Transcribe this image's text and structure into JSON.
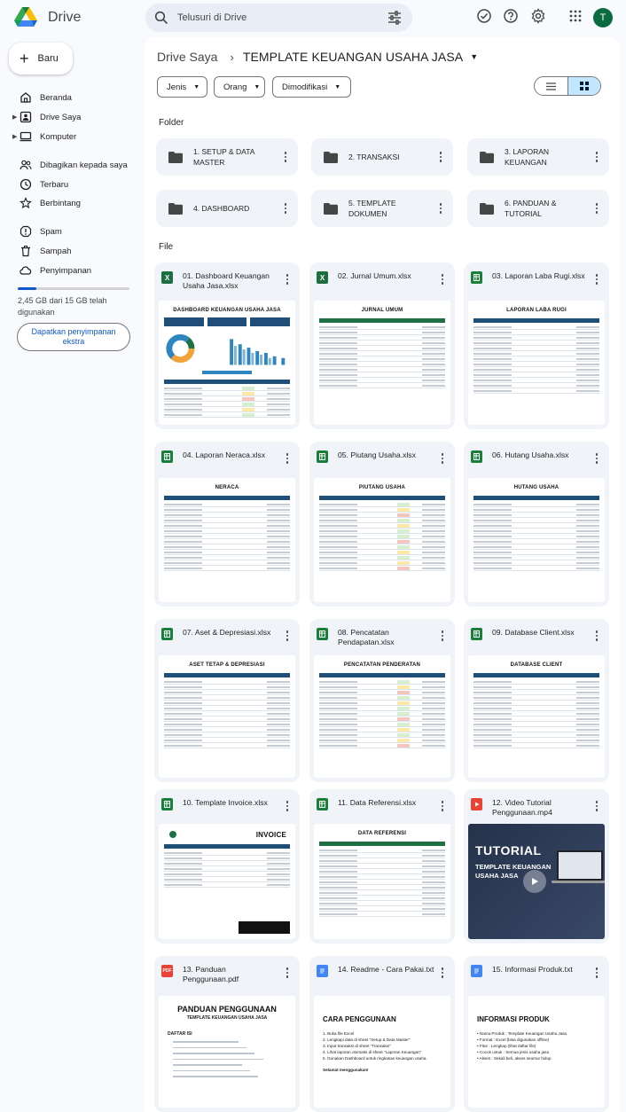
{
  "app": {
    "name": "Drive"
  },
  "search": {
    "placeholder": "Telusuri di Drive"
  },
  "user": {
    "initial": "T"
  },
  "new_button": {
    "label": "Baru"
  },
  "sidebar": {
    "items": [
      {
        "label": "Beranda",
        "icon": "home-icon"
      },
      {
        "label": "Drive Saya",
        "icon": "my-drive-icon"
      },
      {
        "label": "Komputer",
        "icon": "computer-icon"
      },
      {
        "label": "Dibagikan kepada saya",
        "icon": "shared-icon"
      },
      {
        "label": "Terbaru",
        "icon": "clock-icon"
      },
      {
        "label": "Berbintang",
        "icon": "star-icon"
      },
      {
        "label": "Spam",
        "icon": "spam-icon"
      },
      {
        "label": "Sampah",
        "icon": "trash-icon"
      },
      {
        "label": "Penyimpanan",
        "icon": "cloud-icon"
      }
    ],
    "storage_used_fraction": 0.163,
    "storage_text": "2,45 GB dari 15 GB telah digunakan",
    "get_storage": "Dapatkan penyimpanan ekstra"
  },
  "breadcrumb": {
    "root": "Drive Saya",
    "current": "TEMPLATE  KEUANGAN USAHA JASA"
  },
  "filters": [
    "Jenis",
    "Orang",
    "Dimodifikasi"
  ],
  "sections": {
    "folders": "Folder",
    "files": "File"
  },
  "folders": [
    "1. SETUP & DATA MASTER",
    "2. TRANSAKSI",
    "3. LAPORAN KEUANGAN",
    "4. DASHBOARD",
    "5. TEMPLATE DOKUMEN",
    "6. PANDUAN & TUTORIAL"
  ],
  "files": [
    {
      "name": "01. Dashboard Keuangan Usaha Jasa.xlsx",
      "type": "xlsx-excel",
      "thumb_title": "DASHBOARD KEUANGAN USAHA JASA"
    },
    {
      "name": "02. Jurnal Umum.xlsx",
      "type": "xlsx-excel",
      "thumb_title": "JURNAL UMUM"
    },
    {
      "name": "03. Laporan Laba Rugi.xlsx",
      "type": "xlsx-sheets",
      "thumb_title": "LAPORAN LABA RUGI"
    },
    {
      "name": "04. Laporan Neraca.xlsx",
      "type": "xlsx-sheets",
      "thumb_title": "NERACA"
    },
    {
      "name": "05. Piutang Usaha.xlsx",
      "type": "xlsx-sheets",
      "thumb_title": "PIUTANG USAHA"
    },
    {
      "name": "06. Hutang Usaha.xlsx",
      "type": "xlsx-sheets",
      "thumb_title": "HUTANG USAHA"
    },
    {
      "name": "07. Aset & Depresiasi.xlsx",
      "type": "xlsx-sheets",
      "thumb_title": "ASET TETAP & DEPRESIASI"
    },
    {
      "name": "08. Pencatatan Pendapatan.xlsx",
      "type": "xlsx-sheets",
      "thumb_title": "PENCATATAN PENDERATAN"
    },
    {
      "name": "09. Database Client.xlsx",
      "type": "xlsx-sheets",
      "thumb_title": "DATABASE CLIENT"
    },
    {
      "name": "10. Template Invoice.xlsx",
      "type": "xlsx-sheets",
      "thumb_title": "INVOICE"
    },
    {
      "name": "11. Data Referensi.xlsx",
      "type": "xlsx-sheets",
      "thumb_title": "DATA REFERENSI"
    },
    {
      "name": "12. Video Tutorial Penggunaan.mp4",
      "type": "video",
      "thumb_title": "TUTORIAL",
      "thumb_subtitle": "TEMPLATE KEUANGAN USAHA JASA"
    },
    {
      "name": "13. Panduan Penggunaan.pdf",
      "type": "pdf",
      "thumb_title": "PANDUAN PENGGUNAAN",
      "thumb_subtitle": "TEMPLATE KEUANGAN USAHA JASA",
      "thumb_section": "DAFTAR ISI"
    },
    {
      "name": "14. Readme - Cara Pakai.txt",
      "type": "doc",
      "thumb_title": "CARA PENGGUNAAN",
      "lines": [
        "1. Buka file Excel",
        "2. Lengkapi data di sheet \"Setup & Data Master\"",
        "3. Input transaksi di sheet \"Transaksi\"",
        "4. Lihat laporan otomatis di sheet \"Laporan Keuangan\"",
        "5. Gunakan Dashboard untuk ringkasan keuangan usaha."
      ],
      "closing": "Selamat menggunakan!"
    },
    {
      "name": "15. Informasi Produk.txt",
      "type": "doc",
      "thumb_title": "INFORMASI PRODUK",
      "lines": [
        "• Nama Produk   : Template Keuangan Usaha Jasa",
        "• Format           : Excel (bisa digunakan offline)",
        "• Fitur              : Lengkap (lihat daftar file)",
        "• Cocok untuk    : Semua jenis usaha jasa",
        "• Akses            : Sekali beli, akses seumur hidup"
      ]
    }
  ],
  "colors": {
    "excel": "#1d6f42",
    "sheets": "#188038",
    "pdf": "#ea4335",
    "video": "#ea4335",
    "doc": "#4285f4",
    "accent": "#0b57d0"
  }
}
